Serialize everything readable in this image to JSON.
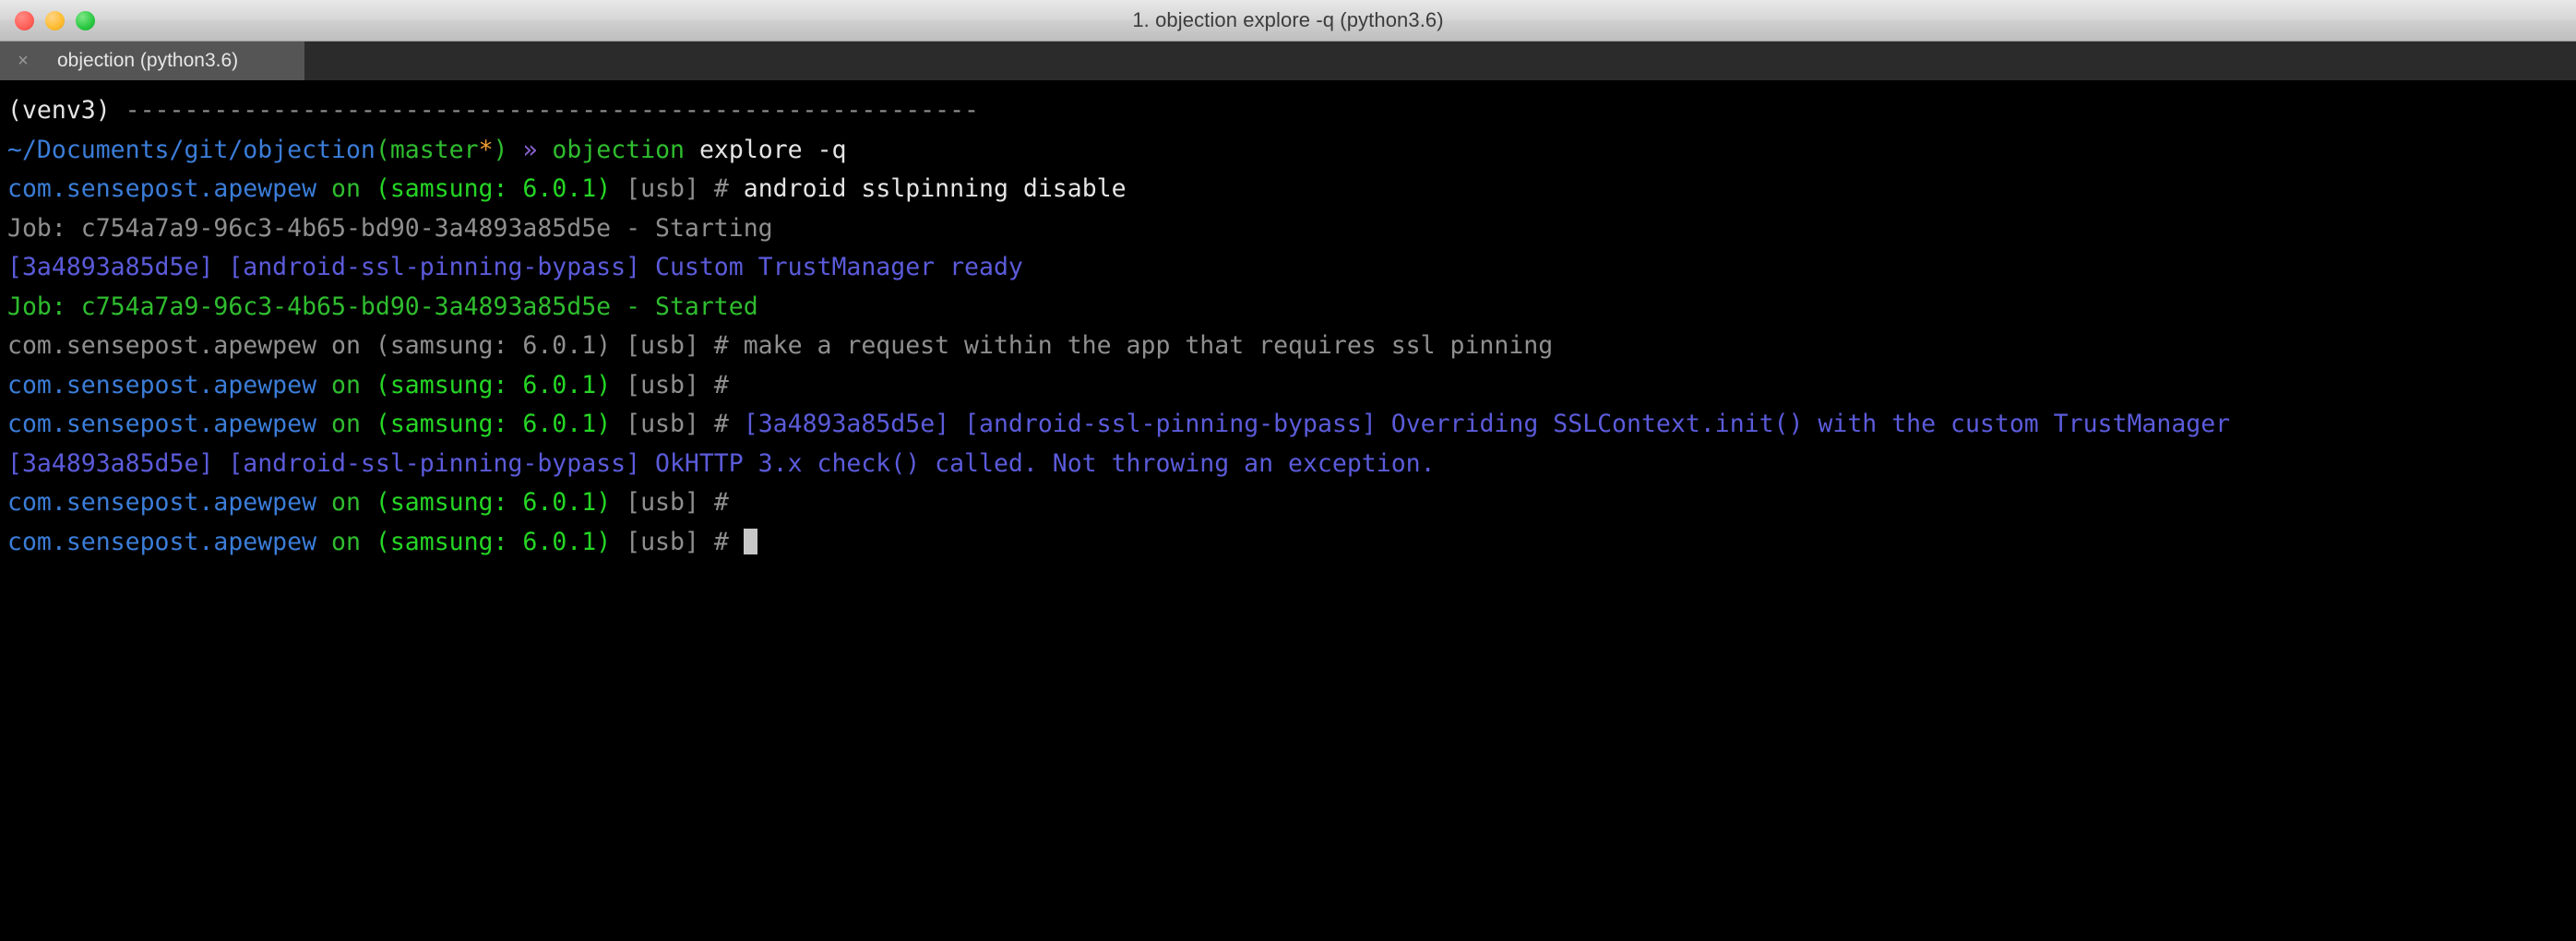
{
  "window": {
    "title": "1. objection explore -q (python3.6)",
    "traffic_lights": [
      {
        "name": "close",
        "color": "#ff5f57"
      },
      {
        "name": "minimize",
        "color": "#febc2e"
      },
      {
        "name": "maximize",
        "color": "#28c840"
      }
    ]
  },
  "tabs": [
    {
      "label": "objection (python3.6)",
      "close_glyph": "×",
      "active": true
    }
  ],
  "theme": {
    "background": "#000000",
    "foreground": "#e5e5e5",
    "gray": "#8f8f8f",
    "blue": "#3b7dd8",
    "green": "#2fbd2f",
    "bright_green": "#25d625",
    "purple": "#8a63d2",
    "orange": "#f0a030",
    "violet": "#5b5bdb",
    "cursor": "#c7c7c7"
  },
  "terminal": {
    "lines": [
      {
        "id": "line-venv-rule",
        "segments": [
          {
            "text": "(venv3) ",
            "color": "white"
          },
          {
            "text": "----------------------------------------------------------",
            "color": "gray"
          }
        ]
      },
      {
        "id": "line-shell-prompt-command",
        "segments": [
          {
            "text": "~/Documents/git/objection",
            "color": "blue"
          },
          {
            "text": "(",
            "color": "green"
          },
          {
            "text": "master",
            "color": "green"
          },
          {
            "text": "*",
            "color": "orange"
          },
          {
            "text": ")",
            "color": "green"
          },
          {
            "text": " ",
            "color": "white"
          },
          {
            "text": "»",
            "color": "purple"
          },
          {
            "text": " ",
            "color": "white"
          },
          {
            "text": "objection",
            "color": "green"
          },
          {
            "text": " explore -q",
            "color": "white"
          }
        ]
      },
      {
        "id": "line-cmd-sslpinning-disable",
        "segments": [
          {
            "text": "com.sensepost.apewpew",
            "color": "blue"
          },
          {
            "text": " on ",
            "color": "green"
          },
          {
            "text": "(samsung: 6.0.1)",
            "color": "bright_green"
          },
          {
            "text": " [usb] # ",
            "color": "gray"
          },
          {
            "text": "android sslpinning disable",
            "color": "white"
          }
        ]
      },
      {
        "id": "line-job-starting",
        "segments": [
          {
            "text": "Job: c754a7a9-96c3-4b65-bd90-3a4893a85d5e - Starting",
            "color": "gray"
          }
        ]
      },
      {
        "id": "line-trustmanager-ready",
        "segments": [
          {
            "text": "[3a4893a85d5e] [android-ssl-pinning-bypass] Custom TrustManager ready",
            "color": "violet"
          }
        ]
      },
      {
        "id": "line-job-started",
        "segments": [
          {
            "text": "Job: c754a7a9-96c3-4b65-bd90-3a4893a85d5e - Started",
            "color": "green"
          }
        ]
      },
      {
        "id": "line-comment-make-request",
        "segments": [
          {
            "text": "com.sensepost.apewpew on (samsung: 6.0.1) [usb] # make a request within the app that requires ssl pinning",
            "color": "gray"
          }
        ]
      },
      {
        "id": "line-empty-prompt-1",
        "segments": [
          {
            "text": "com.sensepost.apewpew",
            "color": "blue"
          },
          {
            "text": " on ",
            "color": "green"
          },
          {
            "text": "(samsung: 6.0.1)",
            "color": "bright_green"
          },
          {
            "text": " [usb] #",
            "color": "gray"
          }
        ]
      },
      {
        "id": "line-overriding-sslcontext",
        "segments": [
          {
            "text": "com.sensepost.apewpew",
            "color": "blue"
          },
          {
            "text": " on ",
            "color": "green"
          },
          {
            "text": "(samsung: 6.0.1)",
            "color": "bright_green"
          },
          {
            "text": " [usb] # ",
            "color": "gray"
          },
          {
            "text": "[3a4893a85d5e] [android-ssl-pinning-bypass] Overriding SSLContext.init() with the custom TrustManager",
            "color": "violet"
          }
        ]
      },
      {
        "id": "line-okhttp-check",
        "segments": [
          {
            "text": "[3a4893a85d5e] [android-ssl-pinning-bypass] OkHTTP 3.x check() called. Not throwing an exception.",
            "color": "violet"
          }
        ]
      },
      {
        "id": "line-empty-prompt-2",
        "segments": [
          {
            "text": "com.sensepost.apewpew",
            "color": "blue"
          },
          {
            "text": " on ",
            "color": "green"
          },
          {
            "text": "(samsung: 6.0.1)",
            "color": "bright_green"
          },
          {
            "text": " [usb] #",
            "color": "gray"
          }
        ]
      },
      {
        "id": "line-active-prompt",
        "cursor": true,
        "segments": [
          {
            "text": "com.sensepost.apewpew",
            "color": "blue"
          },
          {
            "text": " on ",
            "color": "green"
          },
          {
            "text": "(samsung: 6.0.1)",
            "color": "bright_green"
          },
          {
            "text": " [usb] # ",
            "color": "gray"
          }
        ]
      }
    ]
  }
}
